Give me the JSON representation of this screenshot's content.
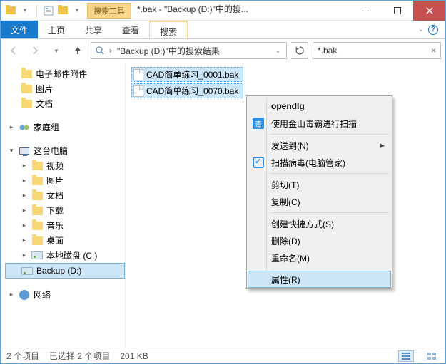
{
  "titlebar": {
    "tools_label": "搜索工具",
    "title": "*.bak - \"Backup (D:)\"中的搜..."
  },
  "ribbon": {
    "file": "文件",
    "home": "主页",
    "share": "共享",
    "view": "查看",
    "search": "搜索"
  },
  "nav": {
    "breadcrumb": "\"Backup (D:)\"中的搜索结果",
    "search_value": "*.bak"
  },
  "tree": {
    "fav_email": "电子邮件附件",
    "fav_pictures": "图片",
    "fav_docs": "文档",
    "homegroup": "家庭组",
    "this_pc": "这台电脑",
    "videos": "视频",
    "pictures": "图片",
    "docs": "文档",
    "downloads": "下载",
    "music": "音乐",
    "desktop": "桌面",
    "local_c": "本地磁盘 (C:)",
    "backup_d": "Backup (D:)",
    "network": "网络"
  },
  "files": [
    "CAD简单练习_0001.bak",
    "CAD简单练习_0070.bak"
  ],
  "context_menu": {
    "opendlg": "opendlg",
    "kingsoft_scan": "使用金山毒霸进行扫描",
    "send_to": "发送到(N)",
    "tencent_scan": "扫描病毒(电脑管家)",
    "cut": "剪切(T)",
    "copy": "复制(C)",
    "create_shortcut": "创建快捷方式(S)",
    "delete": "删除(D)",
    "rename": "重命名(M)",
    "properties": "属性(R)"
  },
  "statusbar": {
    "item_count": "2 个项目",
    "selection": "已选择 2 个项目",
    "size": "201 KB"
  }
}
